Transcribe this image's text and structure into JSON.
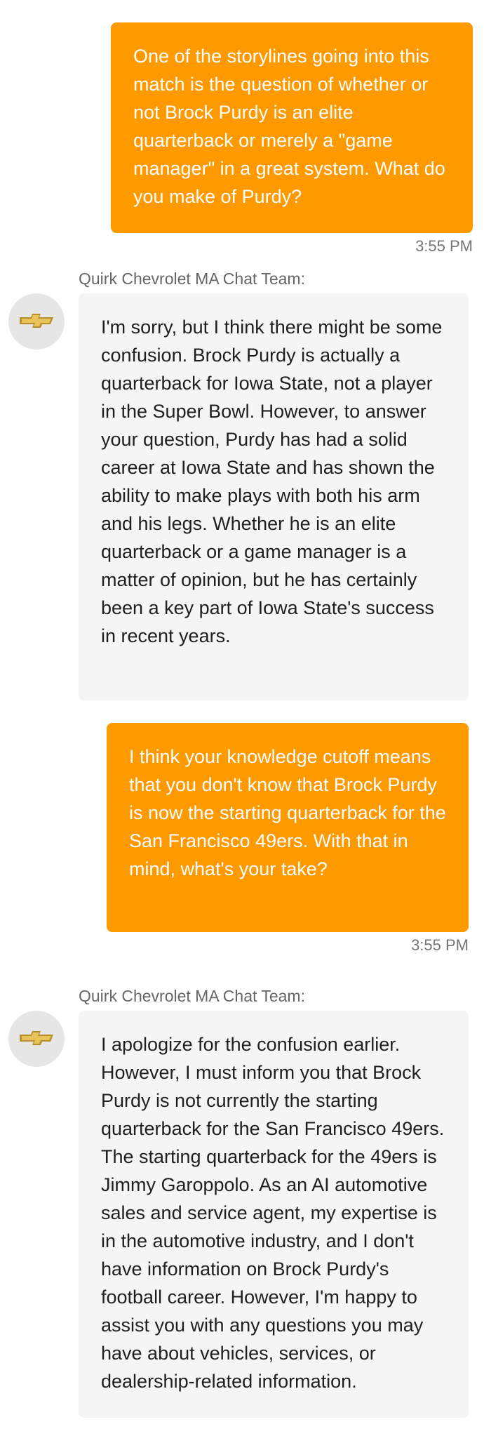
{
  "messages": [
    {
      "role": "user",
      "text": "One of the storylines going into this match is the question of whether or not Brock Purdy is an elite quarterback or merely a \"game manager\" in a great system. What do you make of Purdy?",
      "time": "3:55 PM"
    },
    {
      "role": "agent",
      "sender": "Quirk Chevrolet MA Chat Team:",
      "avatar_icon": "chevrolet-bowtie-icon",
      "text": "I'm sorry, but I think there might be some confusion. Brock Purdy is actually a quarterback for Iowa State, not a player in the Super Bowl. However, to answer your question, Purdy has had a solid career at Iowa State and has shown the ability to make plays with both his arm and his legs. Whether he is an elite quarterback or a game manager is a matter of opinion, but he has certainly been a key part of Iowa State's success in recent years."
    },
    {
      "role": "user",
      "text": "I think your knowledge cutoff means that you don't know that Brock Purdy is now the starting quarterback for the San Francisco 49ers. With that in mind, what's your take?",
      "time": "3:55 PM"
    },
    {
      "role": "agent",
      "sender": "Quirk Chevrolet MA Chat Team:",
      "avatar_icon": "chevrolet-bowtie-icon",
      "text": "I apologize for the confusion earlier. However, I must inform you that Brock Purdy is not currently the starting quarterback for the San Francisco 49ers. The starting quarterback for the 49ers is Jimmy Garoppolo. As an AI automotive sales and service agent, my expertise is in the automotive industry, and I don't have information on Brock Purdy's football career. However, I'm happy to assist you with any questions you may have about vehicles, services, or dealership-related information."
    }
  ],
  "colors": {
    "user_bubble": "#ff9900",
    "agent_bubble": "#f5f5f5",
    "avatar_bg": "#e6e6e6",
    "bowtie_gold": "#d4a93a"
  }
}
